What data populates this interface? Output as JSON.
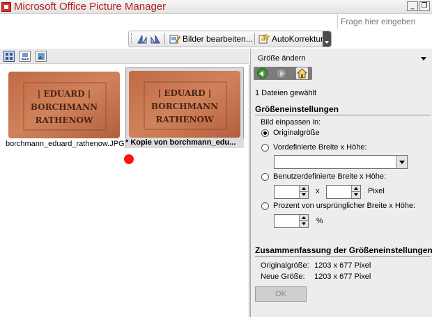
{
  "window": {
    "title": "Microsoft Office Picture Manager",
    "minimize_symbol": "_",
    "restore_symbol": "❐"
  },
  "help": {
    "placeholder": "Frage hier eingeben"
  },
  "toolbar": {
    "edit_label": "Bilder bearbeiten...",
    "autocorrect_label": "AutoKorrektur",
    "icons": [
      "rotate-left-icon",
      "rotate-right-icon",
      "edit-pictures-icon",
      "autocorrect-icon"
    ]
  },
  "view_buttons": [
    "thumbnails-view-icon",
    "filmstrip-view-icon",
    "single-picture-view-icon"
  ],
  "thumbnails": [
    {
      "filename": "borchmann_eduard_rathenow.JPG",
      "stamp_lines": [
        "| EDUARD |",
        "BORCHMANN",
        "RATHENOW"
      ],
      "selected": false
    },
    {
      "filename": "* Kopie von borchmann_edu...",
      "stamp_lines": [
        "| EDUARD |",
        "BORCHMANN",
        "RATHENOW"
      ],
      "selected": true
    }
  ],
  "task_pane": {
    "title": "Größe ändern",
    "files_selected": "1 Dateien gewählt",
    "size_settings_title": "Größeneinstellungen",
    "fit_label": "Bild einpassen in:",
    "options": {
      "original": "Originalgröße",
      "predefined": "Vordefinierte Breite x Höhe:",
      "custom": "Benutzerdefinierte Breite x Höhe:",
      "percent": "Prozent von ursprünglicher Breite x Höhe:"
    },
    "selected_option": "original",
    "predefined_value": "",
    "custom_width": "",
    "custom_height": "",
    "times": "x",
    "pixel_unit": "Pixel",
    "percent_value": "",
    "percent_unit": "%",
    "summary_title": "Zusammenfassung der Größeneinstellungen",
    "original_size_label": "Originalgröße:",
    "original_size_value": "1203 x 677 Pixel",
    "new_size_label": "Neue Größe:",
    "new_size_value": "1203 x 677 Pixel",
    "ok_label": "OK"
  },
  "colors": {
    "title_text": "#b42020",
    "brick": "#c9764e",
    "pane_bg": "#ededed",
    "marker": "#ff1414"
  }
}
